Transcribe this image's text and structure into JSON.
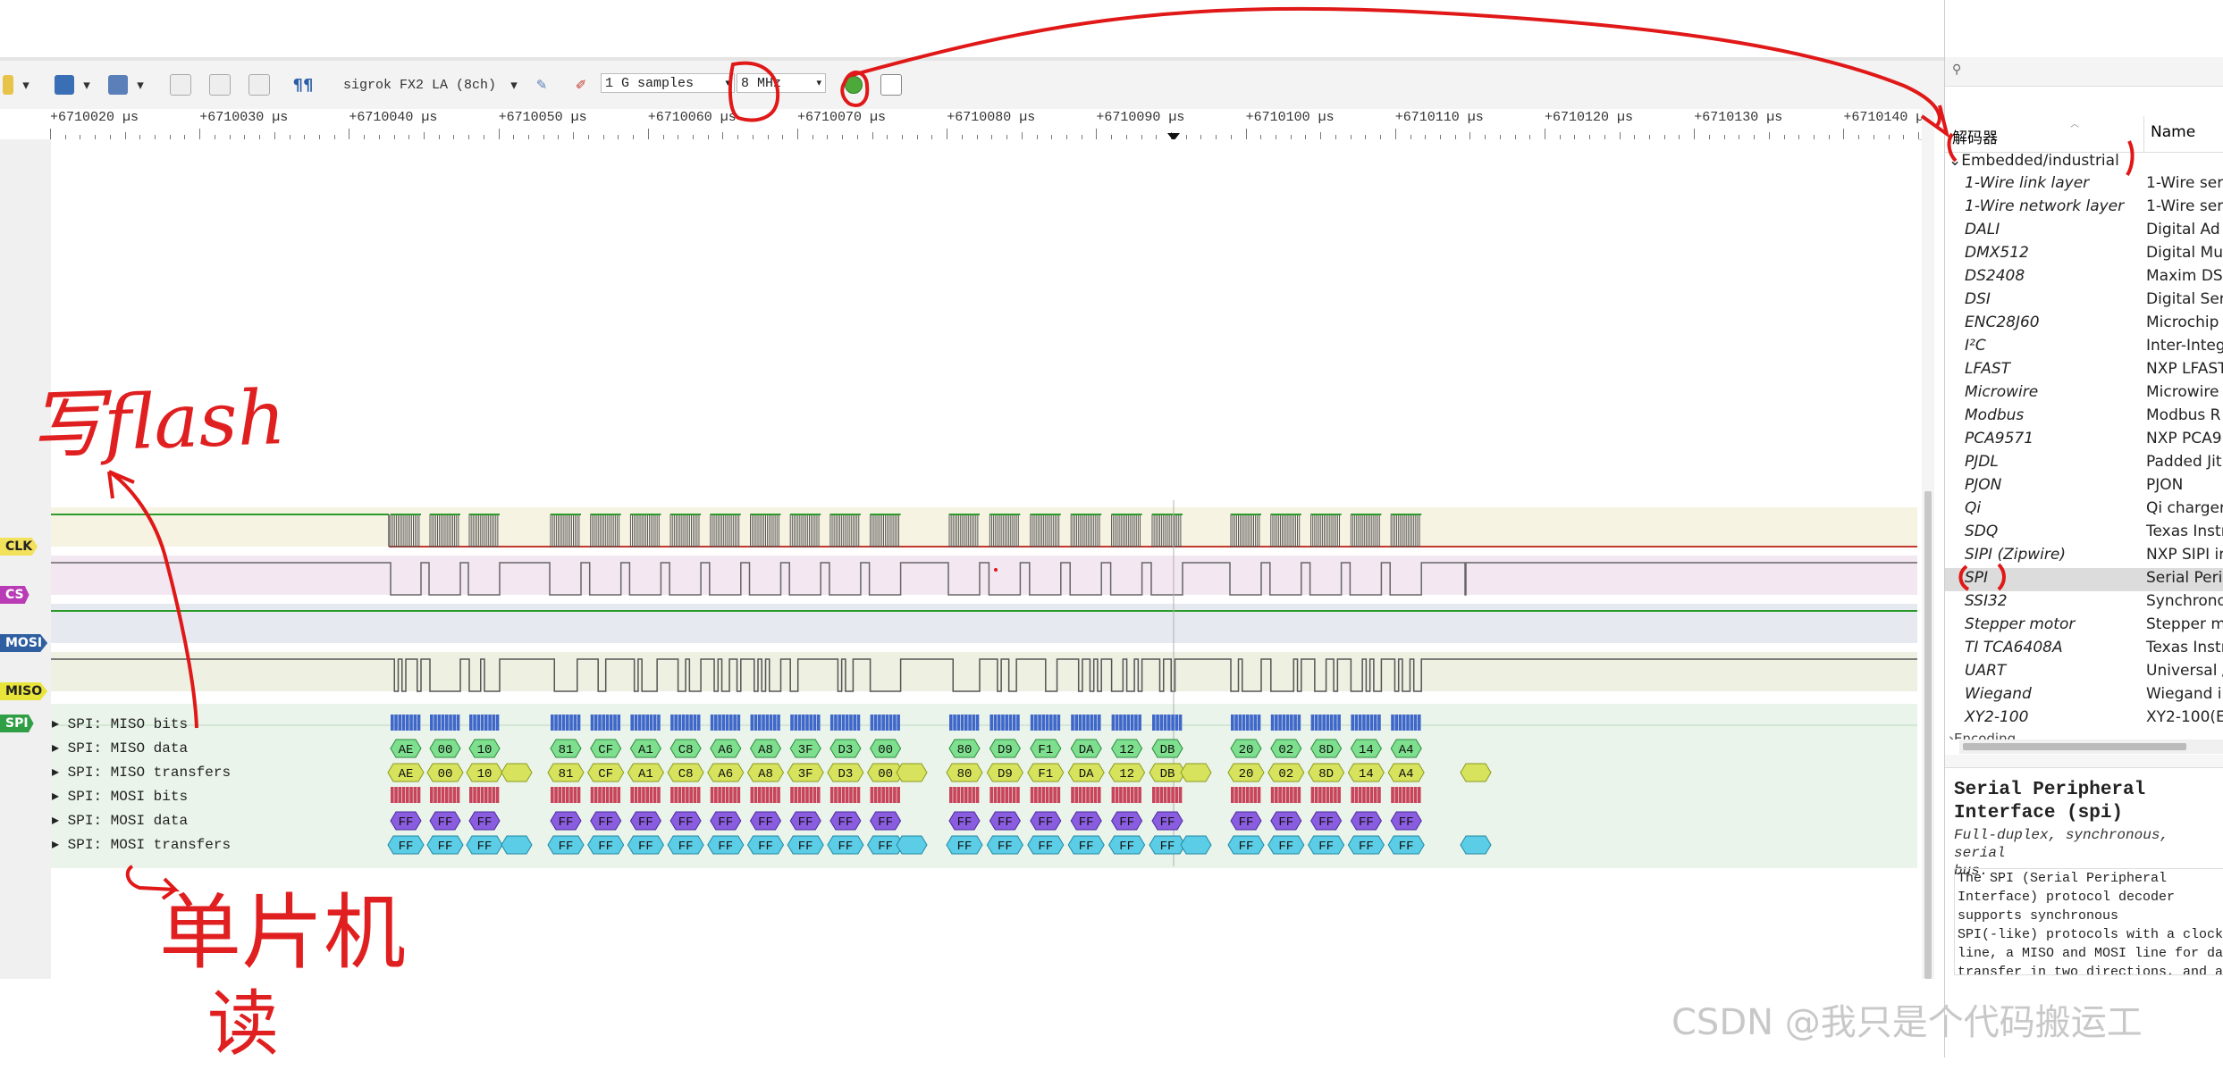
{
  "toolbar": {
    "device": "sigrok FX2 LA (8ch)",
    "samples": "1 G samples",
    "rate": "8 MHz"
  },
  "ruler": {
    "ticks": [
      "+6710020 µs",
      "+6710030 µs",
      "+6710040 µs",
      "+6710050 µs",
      "+6710060 µs",
      "+6710070 µs",
      "+6710080 µs",
      "+6710090 µs",
      "+6710100 µs",
      "+6710110 µs",
      "+6710120 µs",
      "+6710130 µs",
      "+6710140 µs"
    ]
  },
  "channels": [
    "CLK",
    "CS",
    "MOSI",
    "MISO",
    "SPI"
  ],
  "colors": {
    "clk": "#f2e15a",
    "cs": "#b93cb6",
    "mosi": "#2f5fa0",
    "miso": "#e8e43a",
    "spi": "#2f9e45"
  },
  "decoder_rows": [
    "SPI: MISO bits",
    "SPI: MISO data",
    "SPI: MISO transfers",
    "SPI: MOSI bits",
    "SPI: MOSI data",
    "SPI: MOSI transfers"
  ],
  "miso_data": [
    "AE",
    "00",
    "10",
    "",
    "81",
    "CF",
    "A1",
    "C8",
    "A6",
    "A8",
    "3F",
    "D3",
    "00",
    "",
    "80",
    "D9",
    "F1",
    "DA",
    "12",
    "DB",
    "",
    "20",
    "02",
    "8D",
    "14",
    "A4",
    ""
  ],
  "mosi_data": [
    "FF",
    "FF",
    "FF",
    "",
    "FF",
    "FF",
    "FF",
    "FF",
    "FF",
    "FF",
    "FF",
    "FF",
    "FF",
    "",
    "FF",
    "FF",
    "FF",
    "FF",
    "FF",
    "FF",
    "",
    "FF",
    "FF",
    "FF",
    "FF",
    "FF",
    ""
  ],
  "decoder_list": {
    "header_col1": "解码器",
    "header_col2": "Name",
    "category": "Embedded/industrial",
    "items": [
      {
        "id": "1-Wire link layer",
        "name": "1-Wire ser"
      },
      {
        "id": "1-Wire network layer",
        "name": "1-Wire ser"
      },
      {
        "id": "DALI",
        "name": "Digital Ad"
      },
      {
        "id": "DMX512",
        "name": "Digital Mu"
      },
      {
        "id": "DS2408",
        "name": "Maxim DS"
      },
      {
        "id": "DSI",
        "name": "Digital Ser"
      },
      {
        "id": "ENC28J60",
        "name": "Microchip"
      },
      {
        "id": "I²C",
        "name": "Inter-Integ"
      },
      {
        "id": "LFAST",
        "name": "NXP LFAST"
      },
      {
        "id": "Microwire",
        "name": "Microwire"
      },
      {
        "id": "Modbus",
        "name": "Modbus R"
      },
      {
        "id": "PCA9571",
        "name": "NXP PCA9"
      },
      {
        "id": "PJDL",
        "name": "Padded Jit"
      },
      {
        "id": "PJON",
        "name": "PJON"
      },
      {
        "id": "Qi",
        "name": "Qi charger"
      },
      {
        "id": "SDQ",
        "name": "Texas Instr"
      },
      {
        "id": "SIPI (Zipwire)",
        "name": "NXP SIPI ir"
      },
      {
        "id": "SPI",
        "name": "Serial Peri"
      },
      {
        "id": "SSI32",
        "name": "Synchrono"
      },
      {
        "id": "Stepper motor",
        "name": "Stepper m"
      },
      {
        "id": "TI TCA6408A",
        "name": "Texas Instr"
      },
      {
        "id": "UART",
        "name": "Universal /"
      },
      {
        "id": "Wiegand",
        "name": "Wiegand i"
      },
      {
        "id": "XY2-100",
        "name": "XY2-100(E"
      }
    ],
    "next_category": "Encoding"
  },
  "details": {
    "title_line1": "Serial Peripheral",
    "title_line2": "Interface (spi)",
    "subtitle_line1": "Full-duplex, synchronous, serial",
    "subtitle_line2": "bus.",
    "body_lines": [
      "The SPI (Serial Peripheral",
      "Interface) protocol decoder",
      "supports synchronous",
      "SPI(-like) protocols with a clock",
      "line, a MISO and MOSI line for da",
      "transfer in two directions, and a"
    ]
  },
  "annotations": {
    "write_flash": "写flash",
    "mcu_read_line1": "单片机",
    "mcu_read_line2": "读"
  },
  "watermark": "CSDN @我只是个代码搬运工"
}
